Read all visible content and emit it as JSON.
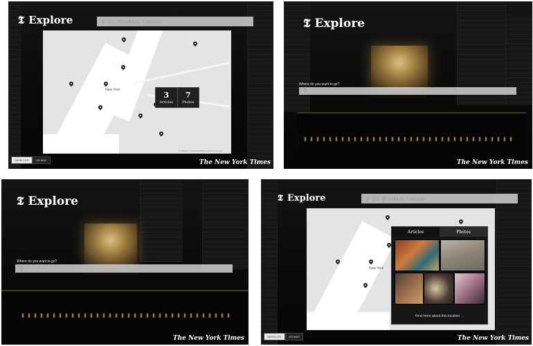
{
  "panels": {
    "p1": {
      "title": "Explore",
      "logo_mark": "𝕿",
      "search_placeholder": "Ex. Brooklyn, London",
      "popup": {
        "articles_count": "3",
        "articles_label": "Articles",
        "photos_count": "7",
        "photos_label": "Photos"
      },
      "place_label": "New York",
      "toggle": [
        "SATELLITE",
        "ON MAP"
      ],
      "nyt": "The New York Times",
      "map_credit": "© Mapbox © OpenStreetMap  Improve this map"
    },
    "p2": {
      "title": "Explore",
      "logo_mark": "𝕿",
      "where_label": "Where do you want to go?",
      "nyt": "The New York Times"
    },
    "p3": {
      "title": "Explore",
      "logo_mark": "𝕿",
      "where_label": "Where do you want to go?",
      "nyt": "The New York Times"
    },
    "p4": {
      "title": "Explore",
      "logo_mark": "𝕿",
      "search_placeholder": "Ex. Brooklyn, London",
      "tabs": [
        "Articles",
        "Photos"
      ],
      "more_link": "Find more about this location →",
      "place_label": "New York",
      "toggle": [
        "SATELLITE",
        "ON MAP"
      ],
      "nyt": "The New York Times"
    }
  },
  "colors": {
    "background": "#0d0d0d",
    "accent_glow": "#e6b45a",
    "map": "#e4e4e4"
  },
  "icons": [
    "search-icon",
    "map-pin-icon"
  ]
}
